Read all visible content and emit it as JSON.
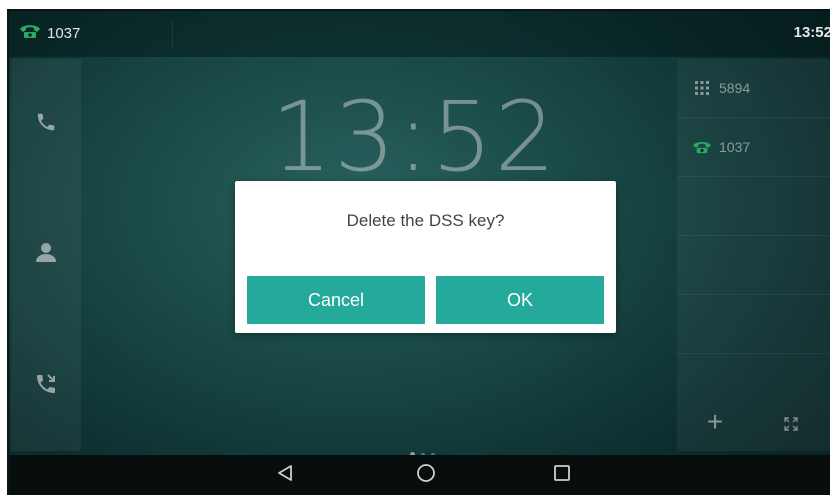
{
  "status_bar": {
    "account": "1037",
    "time": "13:52"
  },
  "clock": {
    "time": "13:52"
  },
  "left_panel": {
    "buttons": [
      {
        "icon": "handset-icon"
      },
      {
        "icon": "contacts-icon"
      },
      {
        "icon": "call-history-icon"
      }
    ]
  },
  "dss_keys": [
    {
      "icon": "dialpad-icon",
      "label": "5894"
    },
    {
      "icon": "line-phone-icon",
      "label": "1037"
    }
  ],
  "right_panel_controls": {
    "add_label": "+",
    "expand_icon": "expand-icon"
  },
  "page_indicator": {
    "count": 3,
    "active_index": 0
  },
  "nav_bar": {
    "buttons": [
      {
        "icon": "back-triangle-icon"
      },
      {
        "icon": "home-circle-icon"
      },
      {
        "icon": "recents-square-icon"
      }
    ]
  },
  "dialog": {
    "message": "Delete the DSS key?",
    "cancel_label": "Cancel",
    "ok_label": "OK"
  },
  "colors": {
    "accent": "#24a99a",
    "line_icon_green": "#2fbf71"
  }
}
